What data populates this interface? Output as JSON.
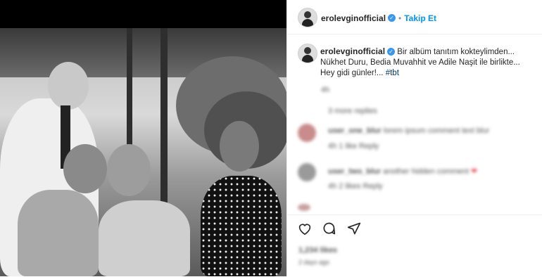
{
  "header": {
    "username": "erolevginofficial",
    "verified_mark": "✓",
    "separator": "•",
    "follow_label": "Takip Et"
  },
  "caption": {
    "username": "erolevginofficial",
    "verified_mark": "✓",
    "line1": "Bir albüm tanıtım kokteylimden...",
    "line2": "Nükhet Duru, Bedia Muvahhit ve Adile Naşit ile birlikte...",
    "line3": "Hey gidi günler!...",
    "hashtag": "#tbt",
    "time": "4h"
  },
  "comments": {
    "load_more": "3 more replies",
    "items": [
      {
        "username": "user_one_blur",
        "text": "lorem ipsum comment text blur",
        "meta": "4h  1 like  Reply"
      },
      {
        "username": "user_two_blur",
        "text": "another hidden comment",
        "heart": "❤",
        "meta": "4h  2 likes  Reply"
      }
    ]
  },
  "actions": {
    "like_icon": "heart-icon",
    "comment_icon": "comment-icon",
    "share_icon": "share-icon",
    "likes_text": "1,234 likes",
    "date_text": "2 days ago"
  },
  "colors": {
    "accent": "#0095f6",
    "verified": "#3897f0",
    "heart": "#ed4956"
  }
}
